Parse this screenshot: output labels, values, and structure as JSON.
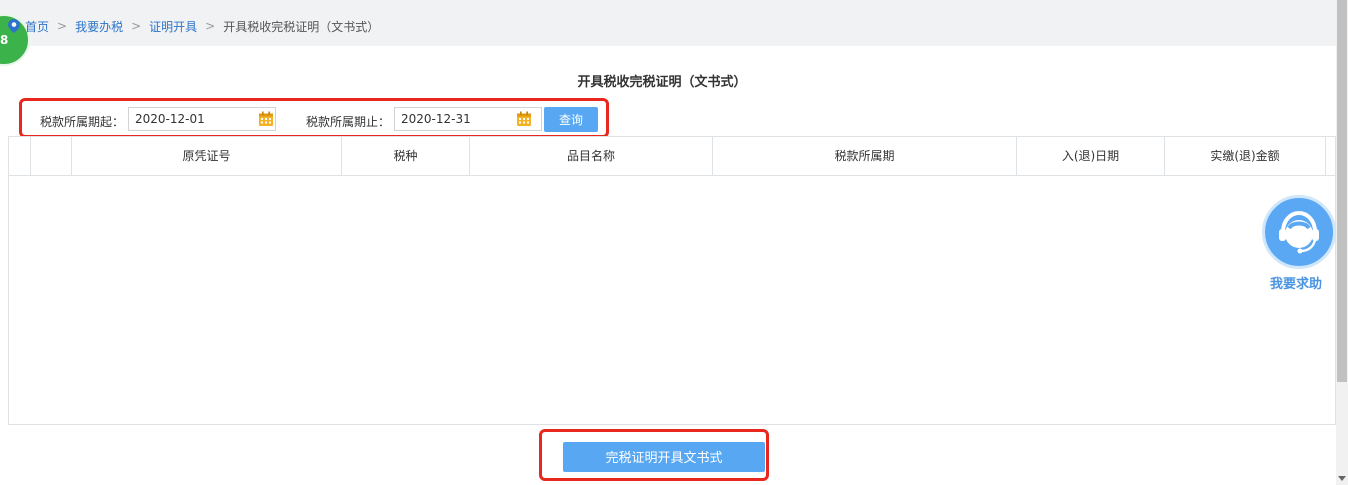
{
  "breadcrumb": {
    "items": [
      "首页",
      "我要办税",
      "证明开具"
    ],
    "separator": ">",
    "current": "开具税收完税证明（文书式）"
  },
  "badge": {
    "text": "8"
  },
  "page": {
    "title": "开具税收完税证明（文书式）"
  },
  "query": {
    "start_label": "税款所属期起：",
    "start_value": "2020-12-01",
    "end_label": "税款所属期止：",
    "end_value": "2020-12-31",
    "query_button": "查询"
  },
  "table": {
    "columns": [
      "",
      "",
      "原凭证号",
      "税种",
      "品目名称",
      "税款所属期",
      "入(退)日期",
      "实缴(退)金额"
    ],
    "rows": []
  },
  "help": {
    "label": "我要求助"
  },
  "actions": {
    "issue_button": "完税证明开具文书式"
  },
  "colors": {
    "accent": "#57a7f2",
    "highlight": "#e8281e",
    "link": "#2d74c9"
  }
}
